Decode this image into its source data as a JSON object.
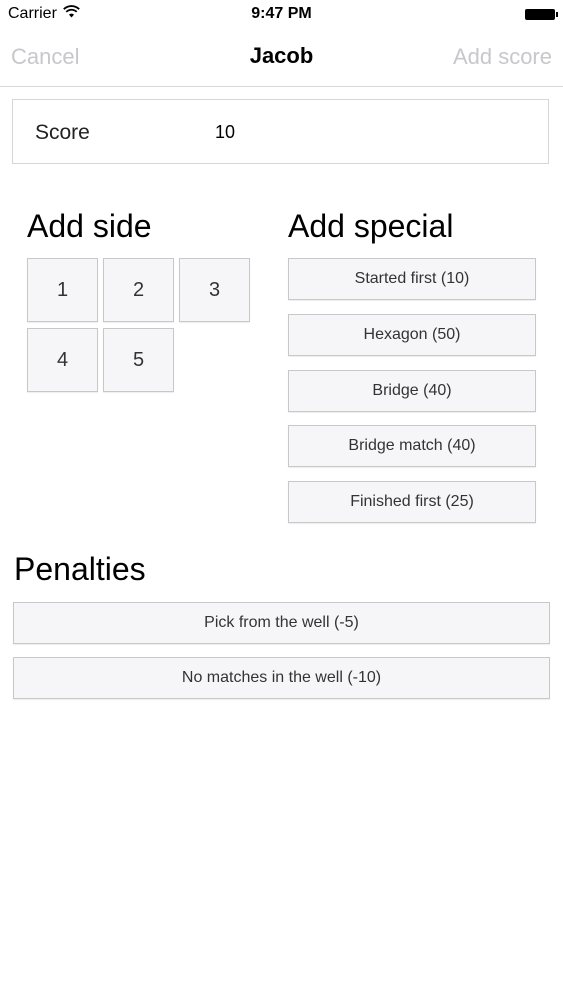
{
  "status_bar": {
    "carrier": "Carrier",
    "time": "9:47 PM",
    "wifi_icon": "wifi-icon",
    "battery_icon": "battery-icon"
  },
  "nav": {
    "cancel_label": "Cancel",
    "title": "Jacob",
    "add_label": "Add score"
  },
  "score": {
    "label": "Score",
    "value": "10"
  },
  "add_side": {
    "title": "Add side",
    "buttons": [
      "1",
      "2",
      "3",
      "4",
      "5"
    ]
  },
  "add_special": {
    "title": "Add special",
    "buttons": [
      "Started first (10)",
      "Hexagon (50)",
      "Bridge (40)",
      "Bridge match (40)",
      "Finished first (25)"
    ]
  },
  "penalties": {
    "title": "Penalties",
    "buttons": [
      "Pick from the well (-5)",
      "No matches in the well (-10)"
    ]
  },
  "colors": {
    "disabled_nav_text": "#c7c7cc",
    "button_background": "#f6f6f8",
    "button_border": "#c8c8c8"
  }
}
